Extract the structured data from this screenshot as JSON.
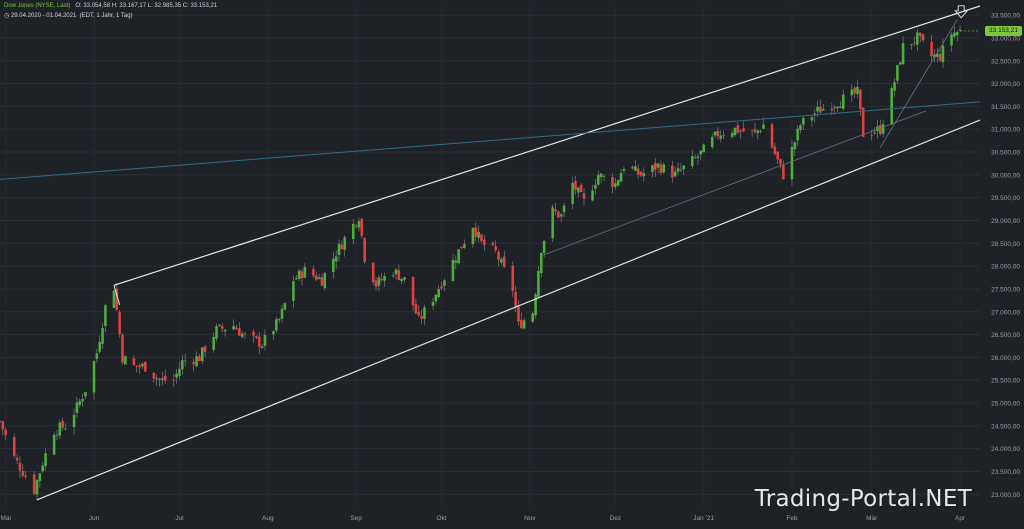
{
  "header": {
    "title": "Dow Jones (NYSE, Last)",
    "ohlc": "O: 33.054,58   H: 33.167,17   L: 32.985,35   C: 33.153,21",
    "range": "29.04.2020 - 01.04.2021",
    "info": "(EDT, 1 Jahr, 1 Tag)"
  },
  "watermark": "Trading-Portal.NET",
  "last_price_label": "33.153,21",
  "colors": {
    "up": "#4caf3a",
    "down": "#e2413f",
    "background": "#1e2126",
    "channel": "#e6e6e6",
    "trend": "#2e6b86",
    "accent": "#7ec83e"
  },
  "chart_data": {
    "type": "candlestick",
    "x_ticks": [
      "Mai",
      "Jun",
      "Jul",
      "Aug",
      "Sep",
      "Okt",
      "Nov",
      "Dez",
      "Jan '21",
      "Feb",
      "Mär",
      "Apr"
    ],
    "y_ticks": [
      "23.000,00",
      "23.500,00",
      "24.000,00",
      "24.500,00",
      "25.000,00",
      "25.500,00",
      "26.000,00",
      "26.500,00",
      "27.000,00",
      "27.500,00",
      "28.000,00",
      "28.500,00",
      "29.000,00",
      "29.500,00",
      "30.000,00",
      "30.500,00",
      "31.000,00",
      "31.500,00",
      "32.000,00",
      "32.500,00",
      "33.000,00",
      "33.500,00"
    ],
    "ylim": [
      22700,
      33700
    ],
    "xlim": [
      "2020-04-29",
      "2021-04-08"
    ],
    "grid": true,
    "last_price": 33153.21,
    "closes": [
      [
        "2020-04-29",
        24600
      ],
      [
        "2020-05-04",
        23800
      ],
      [
        "2020-05-08",
        23400
      ],
      [
        "2020-05-11",
        23100
      ],
      [
        "2020-05-14",
        23700
      ],
      [
        "2020-05-18",
        24400
      ],
      [
        "2020-05-22",
        24500
      ],
      [
        "2020-05-26",
        24900
      ],
      [
        "2020-05-29",
        25300
      ],
      [
        "2020-06-02",
        26100
      ],
      [
        "2020-06-05",
        27100
      ],
      [
        "2020-06-08",
        27550
      ],
      [
        "2020-06-11",
        26000
      ],
      [
        "2020-06-15",
        25800
      ],
      [
        "2020-06-19",
        25800
      ],
      [
        "2020-06-24",
        25500
      ],
      [
        "2020-06-29",
        25500
      ],
      [
        "2020-07-02",
        25900
      ],
      [
        "2020-07-08",
        26000
      ],
      [
        "2020-07-14",
        26600
      ],
      [
        "2020-07-20",
        26700
      ],
      [
        "2020-07-24",
        26450
      ],
      [
        "2020-07-30",
        26300
      ],
      [
        "2020-08-05",
        26800
      ],
      [
        "2020-08-10",
        27700
      ],
      [
        "2020-08-14",
        27900
      ],
      [
        "2020-08-20",
        27700
      ],
      [
        "2020-08-25",
        28300
      ],
      [
        "2020-09-02",
        29100
      ],
      [
        "2020-09-04",
        28200
      ],
      [
        "2020-09-08",
        27600
      ],
      [
        "2020-09-14",
        27900
      ],
      [
        "2020-09-18",
        27700
      ],
      [
        "2020-09-23",
        26800
      ],
      [
        "2020-09-28",
        27300
      ],
      [
        "2020-10-05",
        28100
      ],
      [
        "2020-10-12",
        28900
      ],
      [
        "2020-10-15",
        28500
      ],
      [
        "2020-10-20",
        28300
      ],
      [
        "2020-10-26",
        27500
      ],
      [
        "2020-10-28",
        26700
      ],
      [
        "2020-11-02",
        27000
      ],
      [
        "2020-11-05",
        28400
      ],
      [
        "2020-11-09",
        29200
      ],
      [
        "2020-11-12",
        29100
      ],
      [
        "2020-11-16",
        29800
      ],
      [
        "2020-11-20",
        29400
      ],
      [
        "2020-11-25",
        30000
      ],
      [
        "2020-12-01",
        29800
      ],
      [
        "2020-12-04",
        30200
      ],
      [
        "2020-12-10",
        30000
      ],
      [
        "2020-12-16",
        30200
      ],
      [
        "2020-12-22",
        30000
      ],
      [
        "2020-12-30",
        30400
      ],
      [
        "2021-01-06",
        30900
      ],
      [
        "2021-01-12",
        31000
      ],
      [
        "2021-01-19",
        30900
      ],
      [
        "2021-01-22",
        31100
      ],
      [
        "2021-01-27",
        30300
      ],
      [
        "2021-01-29",
        30000
      ],
      [
        "2021-02-04",
        31100
      ],
      [
        "2021-02-10",
        31400
      ],
      [
        "2021-02-17",
        31600
      ],
      [
        "2021-02-24",
        31800
      ],
      [
        "2021-02-26",
        30900
      ],
      [
        "2021-03-04",
        31000
      ],
      [
        "2021-03-08",
        31800
      ],
      [
        "2021-03-12",
        32800
      ],
      [
        "2021-03-17",
        33000
      ],
      [
        "2021-03-22",
        32600
      ],
      [
        "2021-03-25",
        32600
      ],
      [
        "2021-03-29",
        33100
      ],
      [
        "2021-04-01",
        33153
      ]
    ]
  }
}
